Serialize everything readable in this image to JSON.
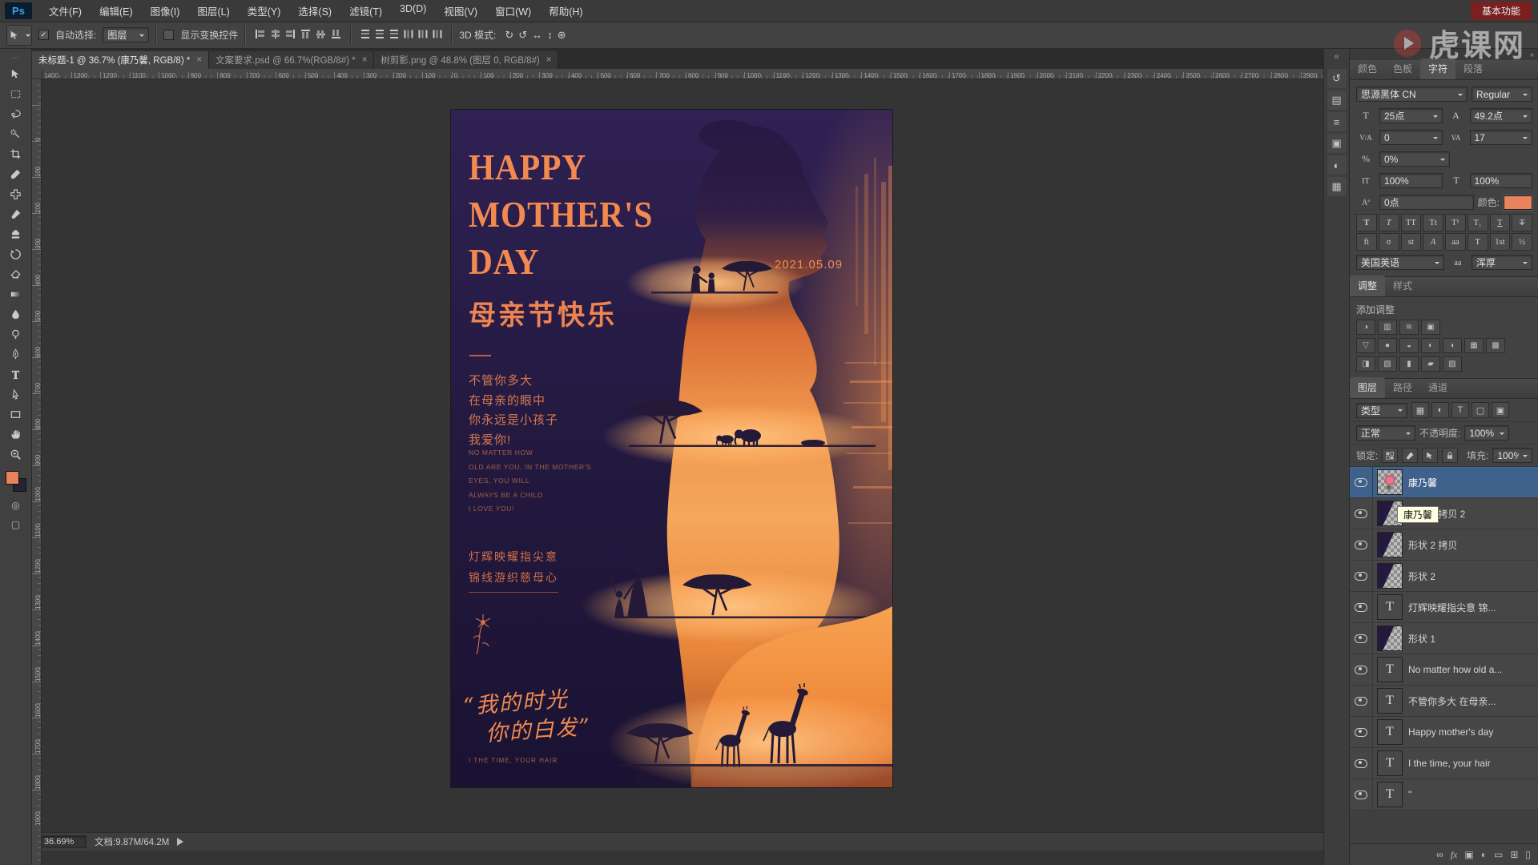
{
  "app": {
    "logo": "Ps",
    "menus": [
      {
        "label": "文件(F)"
      },
      {
        "label": "编辑(E)"
      },
      {
        "label": "图像(I)"
      },
      {
        "label": "图层(L)"
      },
      {
        "label": "类型(Y)"
      },
      {
        "label": "选择(S)"
      },
      {
        "label": "滤镜(T)"
      },
      {
        "label": "3D(D)"
      },
      {
        "label": "视图(V)"
      },
      {
        "label": "窗口(W)"
      },
      {
        "label": "帮助(H)"
      }
    ],
    "workspace_button": "基本功能"
  },
  "options": {
    "auto_select_label": "自动选择:",
    "auto_select_value": "图层",
    "show_transform_label": "显示变换控件",
    "mode3d_label": "3D 模式:",
    "mode3d_icons": [
      {
        "name": "3d-rotate-icon",
        "g": "↻"
      },
      {
        "name": "3d-roll-icon",
        "g": "↺"
      },
      {
        "name": "3d-pan-icon",
        "g": "↔"
      },
      {
        "name": "3d-slide-icon",
        "g": "↕"
      },
      {
        "name": "3d-scale-icon",
        "g": "⊕"
      }
    ],
    "align_icons": [
      {
        "name": "align-left-icon",
        "cls": "al1"
      },
      {
        "name": "align-center-h-icon",
        "cls": "al2"
      },
      {
        "name": "align-right-icon",
        "cls": "al3"
      },
      {
        "name": "align-top-icon",
        "cls": "al1 r90"
      },
      {
        "name": "align-center-v-icon",
        "cls": "al2 r90"
      },
      {
        "name": "align-bottom-icon",
        "cls": "al3 r90"
      }
    ],
    "distribute_icons": [
      {
        "name": "distribute-top-icon",
        "cls": "di"
      },
      {
        "name": "distribute-center-v-icon",
        "cls": "di"
      },
      {
        "name": "distribute-bottom-icon",
        "cls": "di"
      },
      {
        "name": "distribute-left-icon",
        "cls": "di r90"
      },
      {
        "name": "distribute-center-h-icon",
        "cls": "di r90"
      },
      {
        "name": "distribute-right-icon",
        "cls": "di r90"
      }
    ]
  },
  "tabs": [
    {
      "title": "未标题-1 @ 36.7% (康乃馨, RGB/8) *",
      "state": "active"
    },
    {
      "title": "文案要求.psd @ 66.7%(RGB/8#) *",
      "state": ""
    },
    {
      "title": "树剪影.png @ 48.8% (图层 0, RGB/8#)",
      "state": ""
    }
  ],
  "ruler": {
    "h_labels": [
      "1400",
      "1300",
      "1200",
      "1100",
      "1000",
      "900",
      "800",
      "700",
      "600",
      "500",
      "400",
      "300",
      "200",
      "100",
      "0",
      "100",
      "200",
      "300",
      "400",
      "500",
      "600",
      "700",
      "800",
      "900",
      "1000",
      "1100",
      "1200",
      "1300",
      "1400",
      "1500",
      "1600",
      "1700",
      "1800",
      "1900",
      "2000",
      "2100",
      "2200",
      "2300",
      "2400",
      "2500",
      "2600",
      "2700",
      "2800",
      "2900"
    ],
    "v_labels": [
      "0",
      "100",
      "200",
      "300",
      "400",
      "500",
      "600",
      "700",
      "800",
      "900",
      "1000",
      "1100",
      "1200",
      "1300",
      "1400",
      "1500",
      "1600",
      "1700",
      "1800",
      "1900"
    ]
  },
  "toolbar": {
    "tools": [
      {
        "name": "move-tool",
        "icon": "#i-move"
      },
      {
        "name": "marquee-tool",
        "icon": "#i-marquee"
      },
      {
        "name": "lasso-tool",
        "icon": "#i-lasso"
      },
      {
        "name": "quick-selection-tool",
        "icon": "#i-wand"
      },
      {
        "name": "crop-tool",
        "icon": "#i-crop"
      },
      {
        "name": "eyedropper-tool",
        "icon": "#i-eyedrop"
      },
      {
        "name": "healing-brush-tool",
        "icon": "#i-heal"
      },
      {
        "name": "brush-tool",
        "icon": "#i-brush"
      },
      {
        "name": "clone-stamp-tool",
        "icon": "#i-stamp"
      },
      {
        "name": "history-brush-tool",
        "icon": "#i-history"
      },
      {
        "name": "eraser-tool",
        "icon": "#i-eraser"
      },
      {
        "name": "gradient-tool",
        "icon": "#i-gradient"
      },
      {
        "name": "blur-tool",
        "icon": "#i-blur"
      },
      {
        "name": "dodge-tool",
        "icon": "#i-dodge"
      },
      {
        "name": "pen-tool",
        "icon": "#i-pen"
      },
      {
        "name": "type-tool",
        "icon": "#i-type"
      },
      {
        "name": "path-selection-tool",
        "icon": "#i-pathsel"
      },
      {
        "name": "shape-tool",
        "icon": "#i-shape"
      },
      {
        "name": "hand-tool",
        "icon": "#i-hand"
      },
      {
        "name": "zoom-tool",
        "icon": "#i-zoom"
      }
    ],
    "foreground_color": "#e8835c"
  },
  "dock_icons": [
    {
      "name": "history-panel-icon",
      "g": "↺"
    },
    {
      "name": "properties-panel-icon",
      "g": "▤"
    },
    {
      "name": "info-panel-icon",
      "g": "≡"
    },
    {
      "name": "actions-panel-icon",
      "g": "▣"
    },
    {
      "name": "styles-panel-icon",
      "g": "◐"
    },
    {
      "name": "brushes-panel-icon",
      "g": "▦"
    }
  ],
  "poster": {
    "title1": "HAPPY",
    "title2": "MOTHER'S",
    "title3": "DAY",
    "date": "2021.05.09",
    "cn_title": "母亲节快乐",
    "cn_lines": [
      {
        "t": "不管你多大"
      },
      {
        "t": "在母亲的眼中"
      },
      {
        "t": "你永远是小孩子"
      },
      {
        "t": "我爱你!"
      }
    ],
    "en_lines": [
      {
        "t": "NO MATTER HOW"
      },
      {
        "t": "OLD ARE YOU, IN THE MOTHER'S"
      },
      {
        "t": "EYES, YOU WILL"
      },
      {
        "t": "ALWAYS BE A CHILD"
      },
      {
        "t": "I LOVE YOU!"
      }
    ],
    "poem1": "灯辉映耀指尖意",
    "poem2": "锦线游织慈母心",
    "script1": "“我的时光",
    "script2": "你的白发”",
    "bottom_en": "I THE TIME, YOUR HAIR"
  },
  "status": {
    "zoom": "36.69%",
    "doc": "文档:9.87M/64.2M"
  },
  "char_panel": {
    "tabs": [
      {
        "label": "颜色",
        "state": ""
      },
      {
        "label": "色板",
        "state": ""
      },
      {
        "label": "字符",
        "state": "active"
      },
      {
        "label": "段落",
        "state": ""
      }
    ],
    "font_family": "思源黑体 CN",
    "font_style": "Regular",
    "size": "25点",
    "leading": "49.2点",
    "kerning": "0",
    "tracking": "17",
    "prop_spacing": "0%",
    "v_scale": "100%",
    "h_scale": "100%",
    "baseline": "0点",
    "color_label": "颜色:",
    "swatch_color": "#e8835c",
    "format_buttons": [
      {
        "name": "faux-bold-icon",
        "g": "T",
        "cls": "fb"
      },
      {
        "name": "faux-italic-icon",
        "g": "T",
        "cls": "fi"
      },
      {
        "name": "all-caps-icon",
        "g": "TT",
        "cls": ""
      },
      {
        "name": "small-caps-icon",
        "g": "Tt",
        "cls": ""
      },
      {
        "name": "superscript-icon",
        "g": "T¹",
        "cls": ""
      },
      {
        "name": "subscript-icon",
        "g": "T₁",
        "cls": ""
      },
      {
        "name": "underline-icon",
        "g": "T",
        "cls": "u"
      },
      {
        "name": "strikethrough-icon",
        "g": "T",
        "cls": "s"
      }
    ],
    "feature_buttons": [
      {
        "name": "ligatures-icon",
        "g": "fi",
        "cls": ""
      },
      {
        "name": "contextual-alternates-icon",
        "g": "σ",
        "cls": ""
      },
      {
        "name": "discretionary-ligatures-icon",
        "g": "st",
        "cls": ""
      },
      {
        "name": "swash-icon",
        "g": "A",
        "cls": "fi"
      },
      {
        "name": "stylistic-alternates-icon",
        "g": "aa",
        "cls": ""
      },
      {
        "name": "titling-alternates-icon",
        "g": "T",
        "cls": ""
      },
      {
        "name": "ordinals-icon",
        "g": "1st",
        "cls": ""
      },
      {
        "name": "fractions-icon",
        "g": "½",
        "cls": ""
      }
    ],
    "language": "美国英语",
    "antialias": "浑厚"
  },
  "adjust_panel": {
    "tabs": [
      {
        "label": "调整",
        "state": "active"
      },
      {
        "label": "样式",
        "state": ""
      }
    ],
    "add_label": "添加调整",
    "row1": [
      {
        "name": "brightness-contrast-icon",
        "g": "◑"
      },
      {
        "name": "levels-icon",
        "g": "▥"
      },
      {
        "name": "curves-icon",
        "g": "≋"
      },
      {
        "name": "exposure-icon",
        "g": "▣"
      }
    ],
    "row2": [
      {
        "name": "vibrance-icon",
        "g": "▽"
      },
      {
        "name": "hue-saturation-icon",
        "g": "●"
      },
      {
        "name": "color-balance-icon",
        "g": "◒"
      },
      {
        "name": "black-white-icon",
        "g": "◐"
      },
      {
        "name": "photo-filter-icon",
        "g": "◖"
      },
      {
        "name": "channel-mixer-icon",
        "g": "▦"
      },
      {
        "name": "color-lookup-icon",
        "g": "▩"
      }
    ],
    "row3": [
      {
        "name": "invert-icon",
        "g": "◨"
      },
      {
        "name": "posterize-icon",
        "g": "▧"
      },
      {
        "name": "threshold-icon",
        "g": "▮"
      },
      {
        "name": "gradient-map-icon",
        "g": "▰"
      },
      {
        "name": "selective-color-icon",
        "g": "▨"
      }
    ]
  },
  "layers_panel": {
    "tabs": [
      {
        "label": "图层",
        "state": "active"
      },
      {
        "label": "路径",
        "state": ""
      },
      {
        "label": "通道",
        "state": ""
      }
    ],
    "filter_label": "类型",
    "filter_icons": [
      {
        "name": "pixel-layer-filter-icon",
        "g": "▦"
      },
      {
        "name": "adjustment-layer-filter-icon",
        "g": "◐"
      },
      {
        "name": "type-layer-filter-icon",
        "g": "T"
      },
      {
        "name": "shape-layer-filter-icon",
        "g": "▢"
      },
      {
        "name": "smart-object-filter-icon",
        "g": "▣"
      }
    ],
    "blend_mode": "正常",
    "opacity_label": "不透明度:",
    "opacity": "100%",
    "lock_label": "锁定:",
    "fill_label": "填充:",
    "fill": "100%",
    "tooltip": "康乃馨",
    "layers": [
      {
        "name": "康乃馨",
        "kind": "image",
        "content": "flower",
        "state": "selected"
      },
      {
        "name": "形状 2 拷贝 2",
        "kind": "image",
        "content": "shape",
        "state": ""
      },
      {
        "name": "形状 2 拷贝",
        "kind": "image",
        "content": "shape",
        "state": ""
      },
      {
        "name": "形状 2",
        "kind": "image",
        "content": "shape",
        "state": ""
      },
      {
        "name": "灯辉映耀指尖意 锦...",
        "kind": "text",
        "content": "",
        "state": ""
      },
      {
        "name": "形状 1",
        "kind": "image",
        "content": "shape",
        "state": ""
      },
      {
        "name": "No matter how old a...",
        "kind": "text",
        "content": "",
        "state": ""
      },
      {
        "name": "不管你多大 在母亲...",
        "kind": "text",
        "content": "",
        "state": ""
      },
      {
        "name": "Happy mother's day",
        "kind": "text",
        "content": "",
        "state": ""
      },
      {
        "name": "I the time, your hair",
        "kind": "text",
        "content": "",
        "state": ""
      },
      {
        "name": "\"",
        "kind": "text",
        "content": "",
        "state": ""
      }
    ],
    "footer_icons": [
      {
        "name": "link-layers-icon",
        "g": "∞",
        "cls": ""
      },
      {
        "name": "layer-effects-icon",
        "g": "fx",
        "cls": "it"
      },
      {
        "name": "layer-mask-icon",
        "g": "▣",
        "cls": ""
      },
      {
        "name": "new-adjustment-layer-icon",
        "g": "◐",
        "cls": ""
      },
      {
        "name": "new-group-icon",
        "g": "▭",
        "cls": ""
      },
      {
        "name": "new-layer-icon",
        "g": "⊞",
        "cls": ""
      },
      {
        "name": "delete-layer-icon",
        "g": "▯",
        "cls": ""
      }
    ]
  },
  "watermark": {
    "text": "虎课网"
  }
}
